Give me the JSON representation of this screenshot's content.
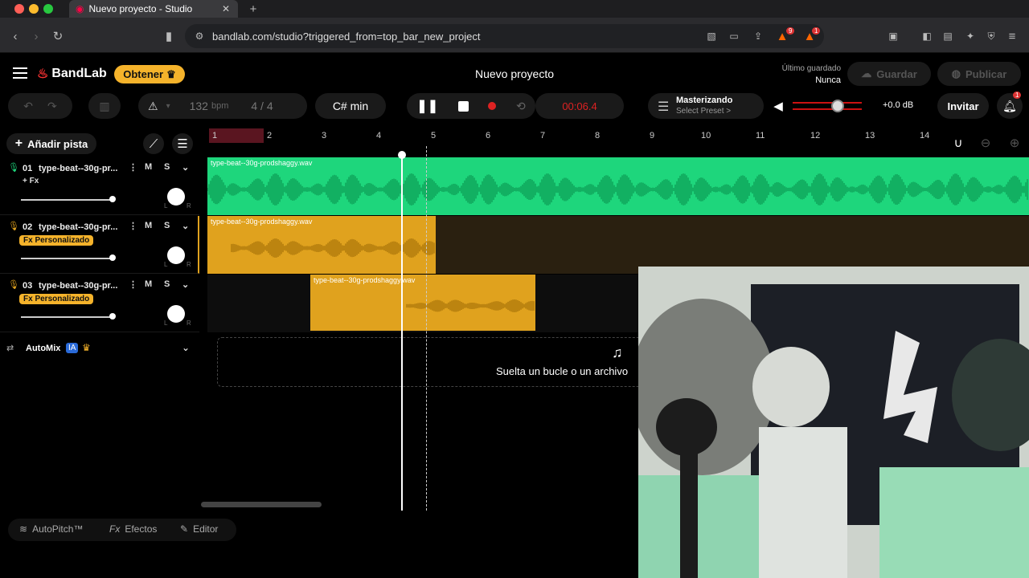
{
  "browser": {
    "tab_title": "Nuevo proyecto - Studio",
    "url": "bandlab.com/studio?triggered_from=top_bar_new_project",
    "notif_badges": [
      "9",
      "1"
    ]
  },
  "header": {
    "logo": "BandLab",
    "obtener": "Obtener",
    "project_title": "Nuevo proyecto",
    "last_saved_label": "Último guardado",
    "last_saved_value": "Nunca",
    "save": "Guardar",
    "publish": "Publicar"
  },
  "toolbar": {
    "bpm_value": "132",
    "bpm_unit": "bpm",
    "time_sig": "4 / 4",
    "key": "C# min",
    "time": "00:06.4",
    "mastering_title": "Masterizando",
    "mastering_preset": "Select Preset >",
    "volume_db": "+0.0 dB",
    "invite": "Invitar",
    "notif_count": "1"
  },
  "left": {
    "add_track": "Añadir pista",
    "tracks": [
      {
        "num": "01",
        "name": "type-beat--30g-pr...",
        "fx": "+ Fx",
        "fx_custom": false
      },
      {
        "num": "02",
        "name": "type-beat--30g-pr...",
        "fx": "Fx Personalizado",
        "fx_custom": true
      },
      {
        "num": "03",
        "name": "type-beat--30g-pr...",
        "fx": "Fx Personalizado",
        "fx_custom": true
      }
    ],
    "mute": "M",
    "solo": "S",
    "automix": "AutoMix",
    "ia": "IA",
    "knob_left": "L",
    "knob_right": "R"
  },
  "ruler": [
    "1",
    "2",
    "3",
    "4",
    "5",
    "6",
    "7",
    "8",
    "9",
    "10",
    "11",
    "12",
    "13",
    "14"
  ],
  "regions": [
    {
      "label": "type-beat--30g-prodshaggy.wav",
      "color": "#1ed67c"
    },
    {
      "label": "type-beat--30g-prodshaggy.wav",
      "color": "#e0a21e"
    },
    {
      "label": "type-beat--30g-prodshaggy.wav",
      "color": "#e0a21e"
    }
  ],
  "drop_text": "Suelta un bucle o un archivo",
  "bottom": {
    "autopitch": "AutoPitch™",
    "effects": "Efectos",
    "editor": "Editor"
  },
  "colors": {
    "accent": "#f5b32b",
    "green": "#1ed67c",
    "orange": "#e0a21e",
    "record": "#d22222"
  }
}
